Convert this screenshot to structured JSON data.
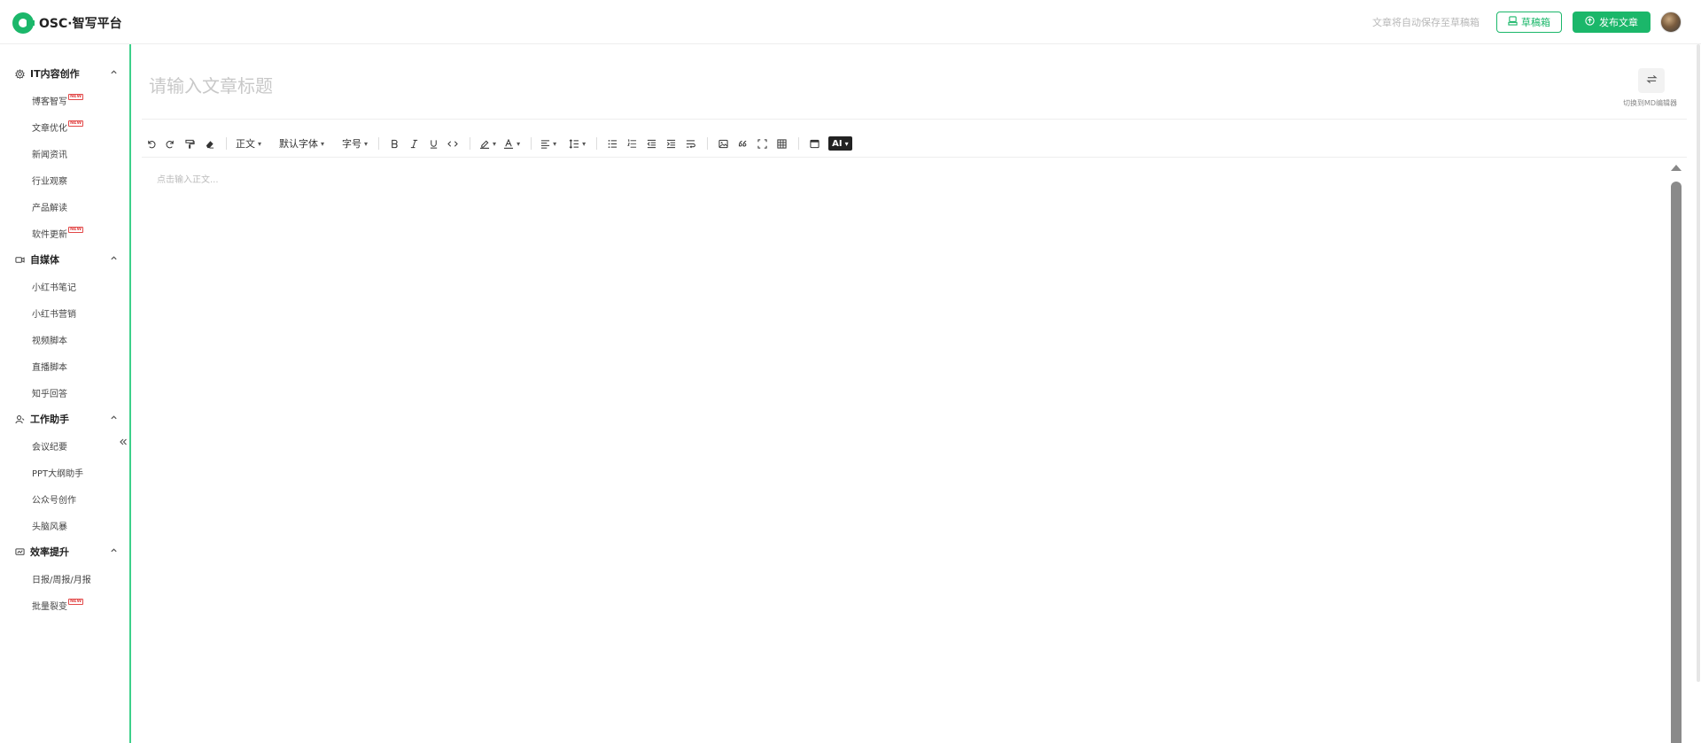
{
  "app": {
    "logo_text": "OSC·智写平台",
    "brand_color": "#1bb76a"
  },
  "header": {
    "autosave_text": "文章将自动保存至草稿箱",
    "draft_button": "草稿箱",
    "publish_button": "发布文章"
  },
  "sidebar": {
    "groups": [
      {
        "label": "IT内容创作",
        "icon": "gear-icon",
        "items": [
          {
            "label": "博客智写",
            "new": true
          },
          {
            "label": "文章优化",
            "new": true
          },
          {
            "label": "新闻资讯",
            "new": false
          },
          {
            "label": "行业观察",
            "new": false
          },
          {
            "label": "产品解读",
            "new": false
          },
          {
            "label": "软件更新",
            "new": true
          }
        ]
      },
      {
        "label": "自媒体",
        "icon": "video-icon",
        "items": [
          {
            "label": "小红书笔记",
            "new": false
          },
          {
            "label": "小红书营销",
            "new": false
          },
          {
            "label": "视频脚本",
            "new": false
          },
          {
            "label": "直播脚本",
            "new": false
          },
          {
            "label": "知乎回答",
            "new": false
          }
        ]
      },
      {
        "label": "工作助手",
        "icon": "assistant-icon",
        "items": [
          {
            "label": "会议纪要",
            "new": false
          },
          {
            "label": "PPT大纲助手",
            "new": false
          },
          {
            "label": "公众号创作",
            "new": false
          },
          {
            "label": "头脑风暴",
            "new": false
          }
        ]
      },
      {
        "label": "效率提升",
        "icon": "efficiency-icon",
        "items": [
          {
            "label": "日报/周报/月报",
            "new": false
          },
          {
            "label": "批量裂变",
            "new": true
          }
        ]
      }
    ],
    "new_tag": "NEW"
  },
  "editor": {
    "title_placeholder": "请输入文章标题",
    "md_switch_label": "切换到MD编辑器",
    "body_placeholder": "点击输入正文...",
    "toolbar": {
      "paragraph": "正文",
      "font_family": "默认字体",
      "font_size": "字号",
      "ai": "AI"
    }
  }
}
